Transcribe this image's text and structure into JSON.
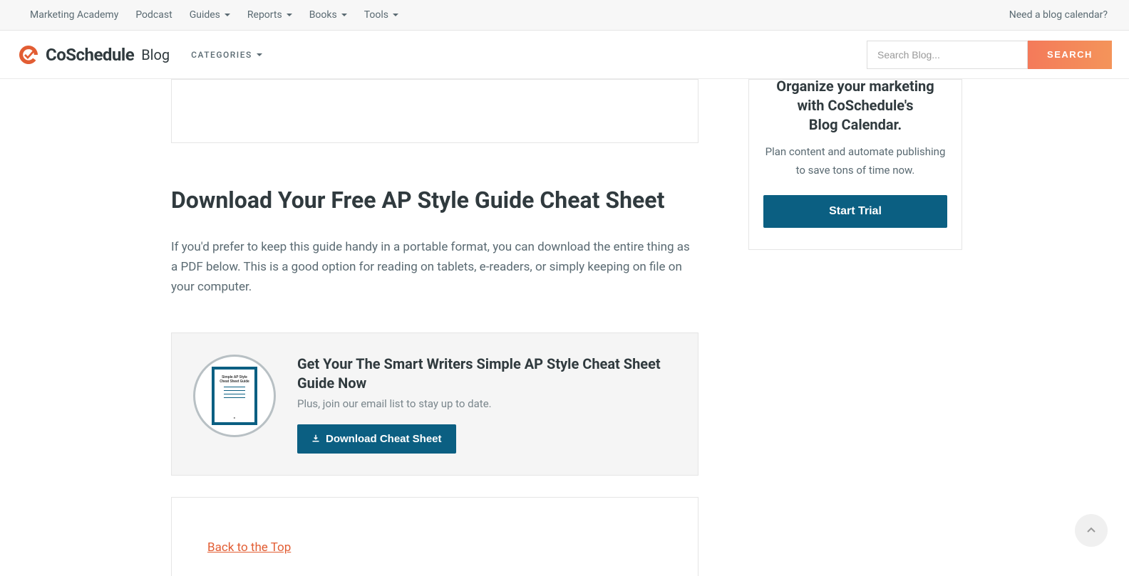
{
  "top_nav": {
    "items": [
      {
        "label": "Marketing Academy",
        "dropdown": false
      },
      {
        "label": "Podcast",
        "dropdown": false
      },
      {
        "label": "Guides",
        "dropdown": true
      },
      {
        "label": "Reports",
        "dropdown": true
      },
      {
        "label": "Books",
        "dropdown": true
      },
      {
        "label": "Tools",
        "dropdown": true
      }
    ],
    "right_link": "Need a blog calendar?"
  },
  "header": {
    "logo_text": "CoSchedule",
    "logo_sub": "Blog",
    "categories_label": "CATEGORIES",
    "search_placeholder": "Search Blog...",
    "search_btn": "SEARCH"
  },
  "article": {
    "heading": "Download Your Free AP Style Guide Cheat Sheet",
    "paragraph": "If you'd prefer to keep this guide handy in a portable format, you can download the entire thing as a PDF below. This is a good option for reading on tablets, e-readers, or simply keeping on file on your computer."
  },
  "download": {
    "title": "Get Your The Smart Writers Simple AP Style Cheat Sheet Guide Now",
    "subtitle": "Plus, join our email list to stay up to date.",
    "button": "Download Cheat Sheet",
    "thumb_text": "Simple AP Style Cheat Sheet Guide"
  },
  "back_link": "Back to the Top",
  "sidebar": {
    "heading_line1": "Organize your marketing",
    "heading_line2": "with CoSchedule's",
    "heading_line3": "Blog Calendar.",
    "sub": "Plan content and automate publishing to save tons of time now.",
    "cta": "Start Trial"
  }
}
